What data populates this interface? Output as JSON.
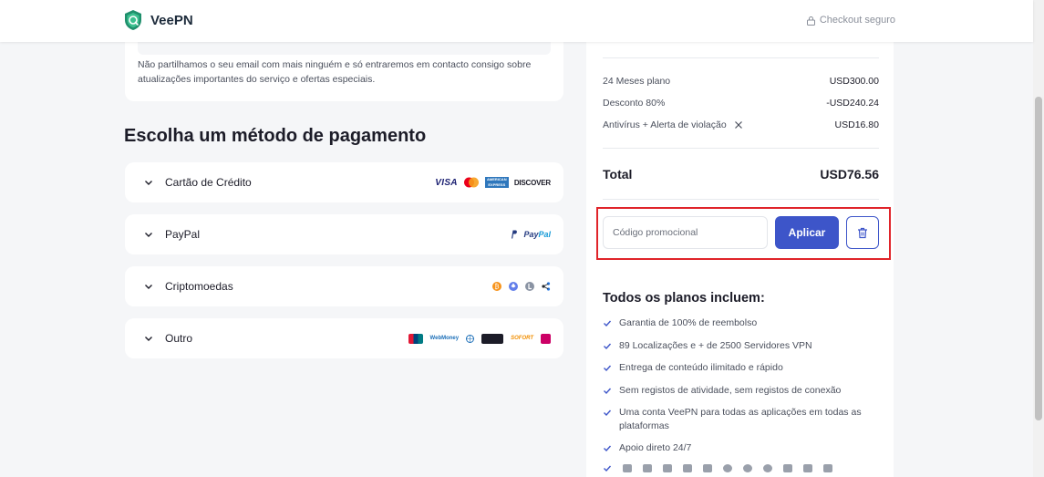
{
  "header": {
    "brand": "VeePN",
    "secure_label": "Checkout seguro",
    "brand_color": "#2fa37e"
  },
  "email_section": {
    "privacy_note": "Não partilhamos o seu email com mais ninguém e só entraremos em contacto consigo sobre atualizações importantes do serviço e ofertas especiais."
  },
  "payment": {
    "title": "Escolha um método de pagamento",
    "methods": [
      {
        "label": "Cartão de Crédito",
        "logos": [
          "visa-logo",
          "mastercard-logo",
          "amex-logo",
          "discover-logo"
        ],
        "visa": "VISA",
        "amex": "AMERICAN EXPRESS",
        "discover": "DISCOVER"
      },
      {
        "label": "PayPal",
        "logos": [
          "paypal-logo"
        ],
        "paypal_a": "Pay",
        "paypal_b": "Pal"
      },
      {
        "label": "Criptomoedas",
        "logos": [
          "bitcoin-icon",
          "ethereum-icon",
          "litecoin-icon",
          "ripple-icon"
        ]
      },
      {
        "label": "Outro",
        "logos": [
          "unionpay-logo",
          "webmoney-logo",
          "giropay-logo",
          "sofort-logo",
          "ideal-logo"
        ],
        "webmoney": "WebMoney",
        "sofort": "SOFORT"
      }
    ]
  },
  "order": {
    "items": [
      {
        "label": "24 Meses plano",
        "amount": "USD300.00"
      },
      {
        "label": "Desconto 80%",
        "amount": "-USD240.24"
      },
      {
        "label": "Antivírus + Alerta de violação",
        "amount": "USD16.80"
      }
    ],
    "total_label": "Total",
    "total_amount": "USD76.56",
    "promo": {
      "placeholder": "Código promocional",
      "apply_label": "Aplicar"
    },
    "accent_color": "#3d55c9",
    "highlight_color": "#e0242a"
  },
  "includes": {
    "title": "Todos os planos incluem:",
    "features": [
      "Garantia de 100% de reembolso",
      "89 Localizações e + de 2500 Servidores VPN",
      "Entrega de conteúdo ilimitado e rápido",
      "Sem registos de atividade, sem registos de conexão",
      "Uma conta VeePN para todas as aplicações em todas as plataformas",
      "Apoio direto 24/7"
    ],
    "platforms": [
      "windows-icon",
      "mac-icon",
      "android-icon",
      "ios-icon",
      "router-icon",
      "chrome-icon",
      "firefox-icon",
      "edge-icon",
      "linux-icon",
      "tv-icon",
      "monitor-icon"
    ]
  }
}
